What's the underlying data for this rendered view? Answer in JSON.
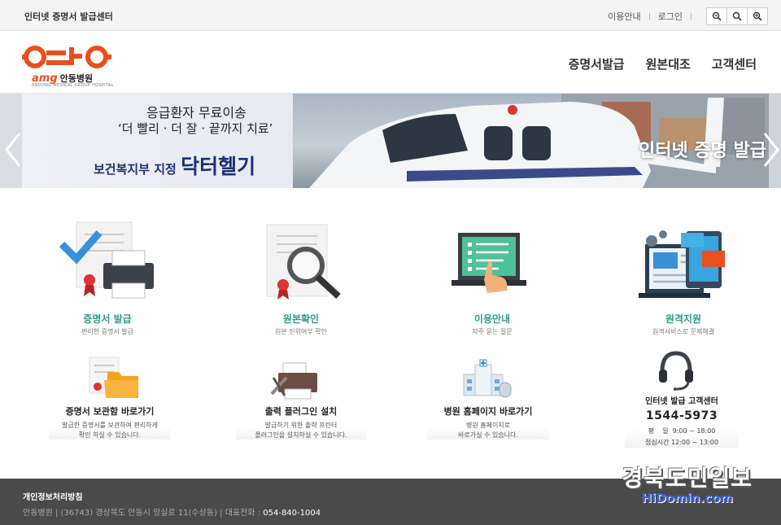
{
  "topbar": {
    "site_name": "인터넷 증명서 발급센터",
    "links": [
      "이용안내",
      "로그인"
    ]
  },
  "header": {
    "logo_hospital": "안동병원",
    "logo_amg": "amg",
    "logo_sub": "ANDONG MEDICAL GROUP HOSPITAL",
    "nav": [
      "증명서발급",
      "원본대조",
      "고객센터"
    ]
  },
  "banner": {
    "line1": "응급환자 무료이송",
    "line2": "‘더 빨리 · 더 잘 · 끝까지 치료’",
    "line3_prefix": "보건복지부 지정",
    "line3_big": "닥터헬기",
    "overlay": "인터넷 증명 발급"
  },
  "services": [
    {
      "title": "증명서 발급",
      "desc": "편리한 증명서 발급"
    },
    {
      "title": "원본확인",
      "desc": "원본 진위여부 확인"
    },
    {
      "title": "이용안내",
      "desc": "자주 묻는 질문"
    },
    {
      "title": "원격지원",
      "desc": "원격서비스로 문제해결"
    }
  ],
  "quicklinks": [
    {
      "title": "증명서 보관함 바로가기",
      "desc1": "발급한 증명서를 보관하여 편리하게",
      "desc2": "확인 하실 수 있습니다."
    },
    {
      "title": "출력 플러그인 설치",
      "desc1": "발급하기 위한 출력 프린터",
      "desc2": "플러그인을 설치하실 수 있습니다."
    },
    {
      "title": "병원 홈페이지 바로가기",
      "desc1": "병원 홈페이지로",
      "desc2": "바로가실 수 있습니다."
    }
  ],
  "contact": {
    "title": "인터넷 발급 고객센터",
    "phone": "1544-5973",
    "hours_weekday": "평    일  9:00 ~ 18:00",
    "hours_lunch": "점심시간 12:00 ~ 13:00"
  },
  "footer": {
    "policy": "개인정보처리방침",
    "address": "안동병원 | (36743) 경상북도 안동시 앙실로 11(수상동) | 대표전화 : ",
    "tel": "054-840-1004"
  },
  "watermark": {
    "line1": "경북도민일보",
    "line2": "HiDomin.com"
  },
  "colors": {
    "accent": "#2f9a85",
    "brand": "#e8501d",
    "footer": "#4a4a4a"
  }
}
